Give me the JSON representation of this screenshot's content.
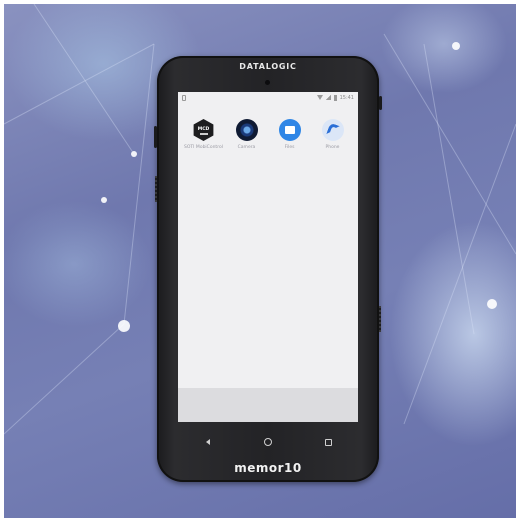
{
  "device": {
    "brand": "DATALOGIC",
    "model": "memor10"
  },
  "status_bar": {
    "time": "15:41"
  },
  "apps": [
    {
      "label": "SOTI MobiControl",
      "icon": "soti-hexagon-icon"
    },
    {
      "label": "Camera",
      "icon": "camera-lens-icon"
    },
    {
      "label": "Files",
      "icon": "folder-icon"
    },
    {
      "label": "Phone",
      "icon": "phone-handset-icon"
    }
  ],
  "navigation": {
    "back_icon": "back-triangle-icon",
    "home_icon": "home-circle-icon",
    "recent_icon": "recent-apps-square-icon"
  },
  "colors": {
    "background": "#7078ae",
    "phone_body": "#232326",
    "screen": "#f0f0f2",
    "files_accent": "#2f86e6"
  }
}
